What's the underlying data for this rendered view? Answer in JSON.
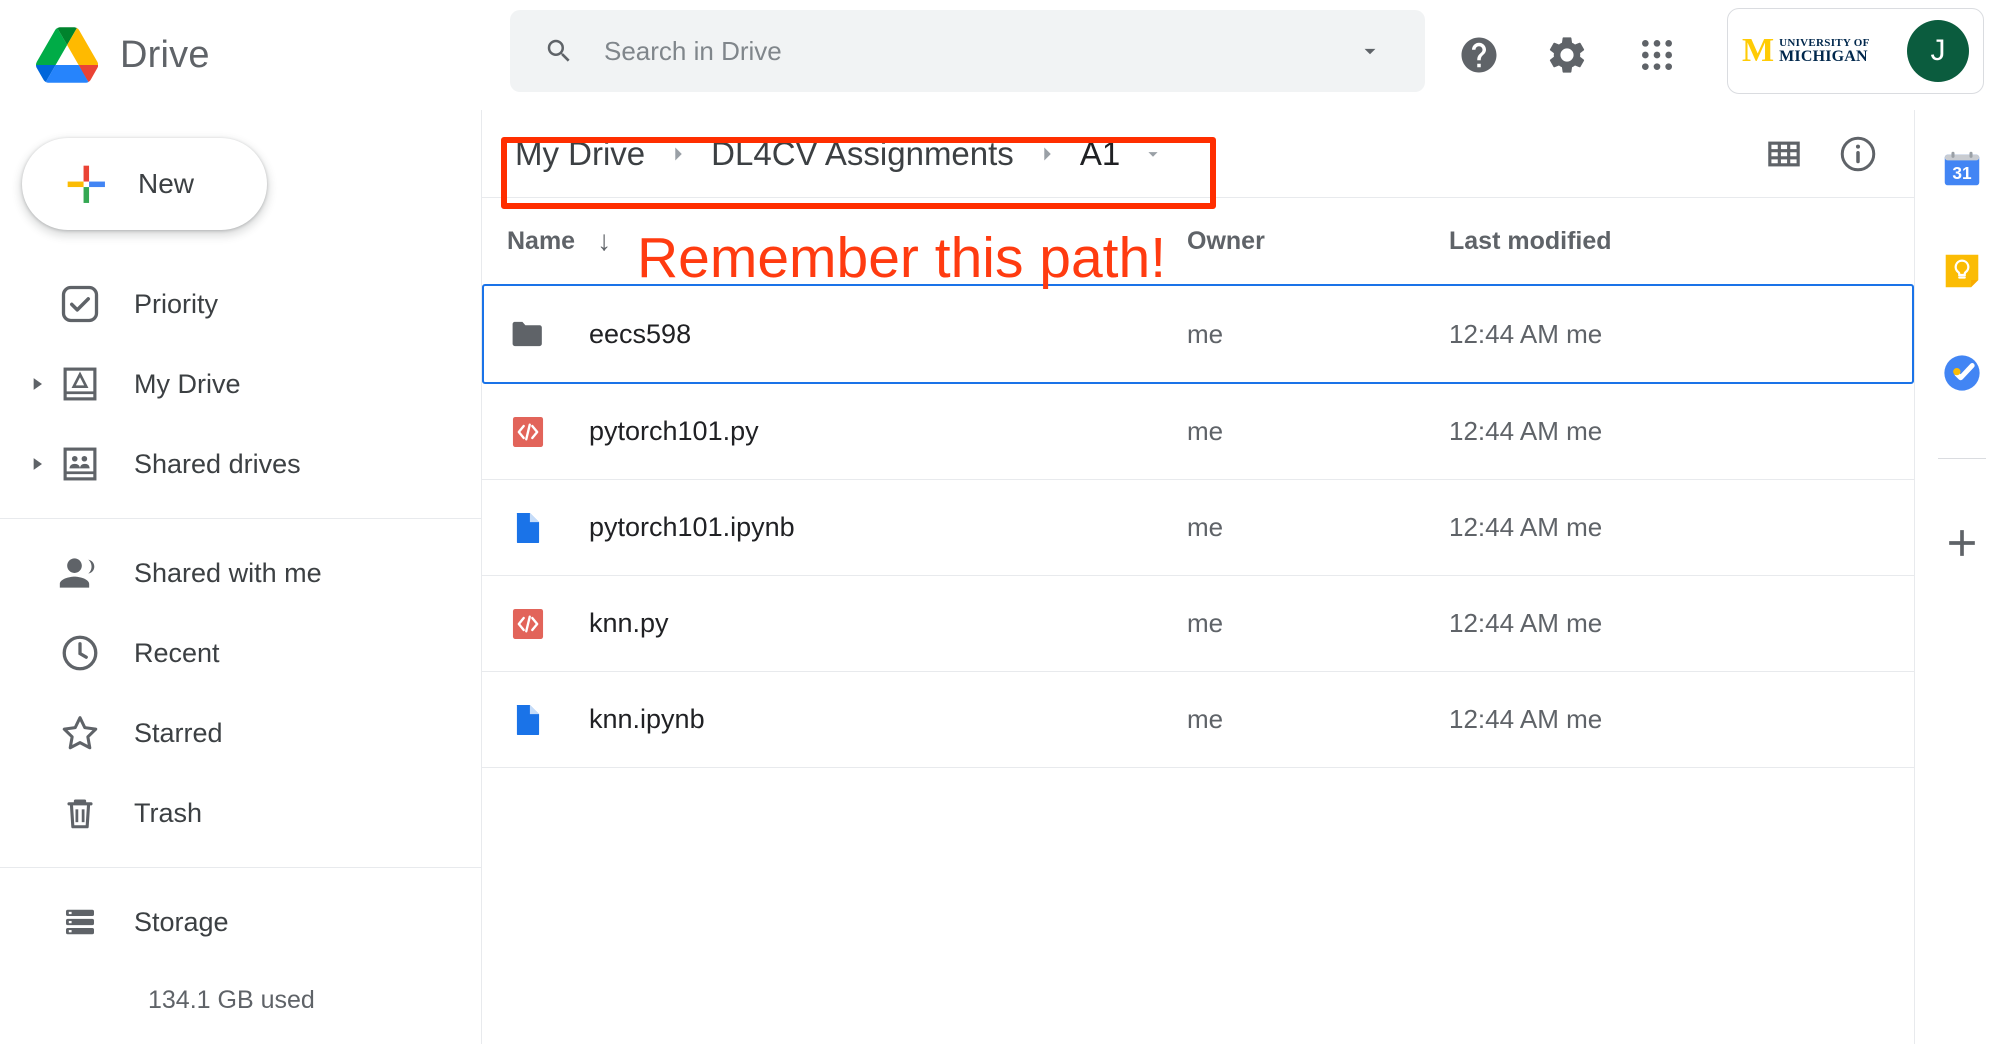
{
  "app": {
    "brand_title": "Drive",
    "logo_name": "google-drive-logo"
  },
  "search": {
    "placeholder": "Search in Drive",
    "value": "",
    "icon": "search-icon",
    "caret_icon": "chevron-down-icon"
  },
  "header_actions": {
    "help_label": "help-icon",
    "settings_label": "gear-icon",
    "apps_label": "apps-grid-icon"
  },
  "account": {
    "org_line1": "UNIVERSITY OF",
    "org_line2": "MICHIGAN",
    "org_mark": "M",
    "avatar_initial": "J",
    "avatar_color": "#0b5c3e",
    "maize": "#FFCB05",
    "navy": "#00274C"
  },
  "sidebar": {
    "new_button": "New",
    "items": [
      {
        "label": "Priority",
        "icon": "priority-check-icon",
        "expandable": false
      },
      {
        "label": "My Drive",
        "icon": "my-drive-icon",
        "expandable": true
      },
      {
        "label": "Shared drives",
        "icon": "shared-drives-icon",
        "expandable": true
      },
      {
        "label": "Shared with me",
        "icon": "people-icon",
        "expandable": false
      },
      {
        "label": "Recent",
        "icon": "clock-icon",
        "expandable": false
      },
      {
        "label": "Starred",
        "icon": "star-icon",
        "expandable": false
      },
      {
        "label": "Trash",
        "icon": "trash-icon",
        "expandable": false
      }
    ],
    "storage": {
      "label": "Storage",
      "icon": "storage-icon",
      "used": "134.1 GB used"
    }
  },
  "breadcrumb": {
    "items": [
      "My Drive",
      "DL4CV Assignments",
      "A1"
    ],
    "separator": "›",
    "dropdown_icon": "breadcrumb-dropdown-icon"
  },
  "toolbar": {
    "grid_view_label": "grid-view-icon",
    "details_label": "info-icon"
  },
  "annotation": {
    "text": "Remember this path!",
    "color": "#FF3B10",
    "box_color": "#FF2E00"
  },
  "table": {
    "columns": [
      "Name",
      "Owner",
      "Last modified"
    ],
    "sort_arrow": "↓",
    "rows": [
      {
        "name": "eecs598",
        "type": "folder",
        "icon": "folder-icon",
        "owner": "me",
        "modified": "12:44 AM  me",
        "selected": true
      },
      {
        "name": "pytorch101.py",
        "type": "code",
        "icon": "code-file-icon",
        "owner": "me",
        "modified": "12:44 AM  me",
        "selected": false
      },
      {
        "name": "pytorch101.ipynb",
        "type": "doc",
        "icon": "notebook-file-icon",
        "owner": "me",
        "modified": "12:44 AM  me",
        "selected": false
      },
      {
        "name": "knn.py",
        "type": "code",
        "icon": "code-file-icon",
        "owner": "me",
        "modified": "12:44 AM  me",
        "selected": false
      },
      {
        "name": "knn.ipynb",
        "type": "doc",
        "icon": "notebook-file-icon",
        "owner": "me",
        "modified": "12:44 AM  me",
        "selected": false
      }
    ]
  },
  "rail": {
    "items": [
      {
        "name": "google-calendar-icon",
        "day": "31"
      },
      {
        "name": "google-keep-icon"
      },
      {
        "name": "google-tasks-icon"
      }
    ],
    "add_label": "add-shortcut-icon"
  },
  "colors": {
    "selection_blue": "#1a73e8",
    "code_icon_red": "#e2645a",
    "doc_icon_blue": "#1a73e8",
    "folder_gray": "#5f6368"
  }
}
